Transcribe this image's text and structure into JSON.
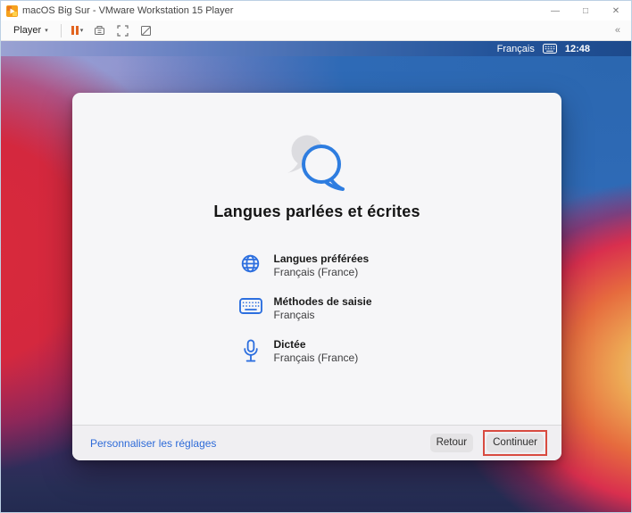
{
  "window": {
    "title": "macOS Big Sur - VMware Workstation 15 Player",
    "controls": {
      "minimize": "—",
      "maximize": "□",
      "close": "✕"
    }
  },
  "toolbar": {
    "player_label": "Player",
    "player_caret": "▾",
    "pause_caret": "▾",
    "collapse_glyph": "«",
    "icon_names": [
      "pause-icon",
      "send-ctrl-alt-del-icon",
      "fullscreen-icon",
      "unity-mode-icon"
    ]
  },
  "menubar": {
    "input_source": "Français",
    "time": "12:48"
  },
  "dialog": {
    "title": "Langues parlées et écrites",
    "items": [
      {
        "icon": "globe-icon",
        "title": "Langues préférées",
        "value": "Français (France)"
      },
      {
        "icon": "keyboard-icon",
        "title": "Méthodes de saisie",
        "value": "Français"
      },
      {
        "icon": "microphone-icon",
        "title": "Dictée",
        "value": "Français (France)"
      }
    ],
    "footer": {
      "customize_link": "Personnaliser les réglages",
      "back_label": "Retour",
      "continue_label": "Continuer"
    }
  },
  "colors": {
    "accent_blue": "#2D6FDF",
    "link_blue": "#2E6BD8",
    "bubble_blue": "#2E7DE0",
    "annotation_red": "#D84B40",
    "pause_orange": "#E2641F",
    "menubar_blue": "#1D4A8C"
  }
}
